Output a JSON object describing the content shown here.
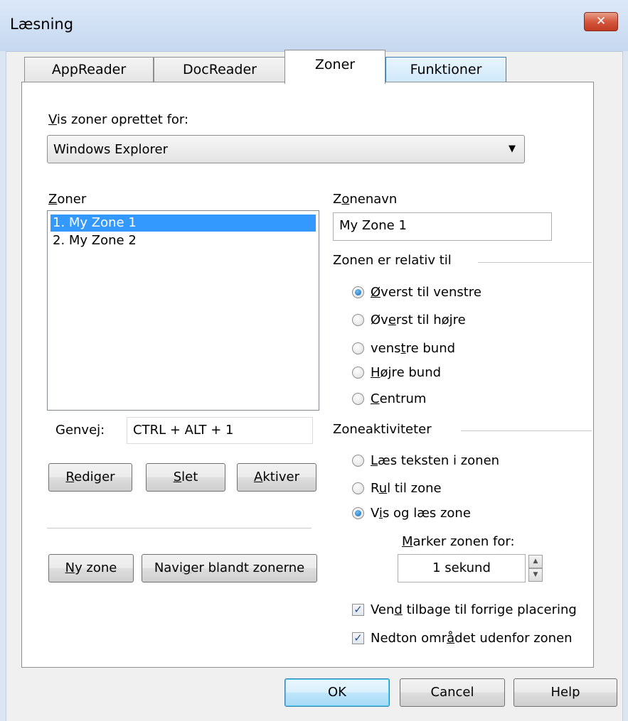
{
  "window": {
    "title": "Læsning",
    "close_label": "✕"
  },
  "tabs": [
    {
      "label": "AppReader"
    },
    {
      "label": "DocReader"
    },
    {
      "label": "Zoner"
    },
    {
      "label": "Funktioner"
    }
  ],
  "show_zones": {
    "label_accel": "V",
    "label_rest": "is zoner oprettet for:",
    "selected_value": "Windows Explorer"
  },
  "zones": {
    "label_accel": "Z",
    "label_rest": "oner",
    "items": [
      "1. My Zone 1",
      "2. My Zone 2"
    ],
    "selected_index": 0
  },
  "shortcut": {
    "label": "Genvej:",
    "value": "CTRL + ALT + 1"
  },
  "buttons": {
    "edit": {
      "accel": "R",
      "rest": "ediger"
    },
    "delete": {
      "accel": "S",
      "rest": "let"
    },
    "activate": {
      "accel": "A",
      "rest": "ktiver"
    },
    "new_zone": {
      "accel": "N",
      "rest": "y zone"
    },
    "navigate": {
      "pre": "Navi",
      "accel": "g",
      "rest": "er blandt zonerne"
    },
    "ok": "OK",
    "cancel": "Cancel",
    "help": "Help"
  },
  "zone_name": {
    "label_pre": "Z",
    "label_accel": "o",
    "label_rest": "nenavn",
    "value": "My Zone 1"
  },
  "relative": {
    "heading": "Zonen er relativ til",
    "options": [
      {
        "pre": "",
        "accel": "Ø",
        "rest": "verst til venstre",
        "checked": true
      },
      {
        "pre": "Øv",
        "accel": "e",
        "rest": "rst til højre",
        "checked": false
      },
      {
        "pre": "vens",
        "accel": "t",
        "rest": "re bund",
        "checked": false
      },
      {
        "pre": "",
        "accel": "H",
        "rest": "øjre bund",
        "checked": false
      },
      {
        "pre": "",
        "accel": "C",
        "rest": "entrum",
        "checked": false
      }
    ]
  },
  "activities": {
    "heading": "Zoneaktiviteter",
    "options": [
      {
        "pre": "",
        "accel": "L",
        "rest": "æs teksten i zonen",
        "checked": false
      },
      {
        "pre": "R",
        "accel": "u",
        "rest": "l til zone",
        "checked": false
      },
      {
        "pre": "V",
        "accel": "i",
        "rest": "s og læs zone",
        "checked": true
      }
    ]
  },
  "highlight": {
    "label_accel": "M",
    "label_rest": "arker zonen for:",
    "value": "1 sekund"
  },
  "checkboxes": [
    {
      "pre": "Ven",
      "accel": "d",
      "rest": " tilbage til forrige placering",
      "checked": true
    },
    {
      "pre": "Nedton omr",
      "accel": "å",
      "rest": "det udenfor zonen",
      "checked": true
    }
  ],
  "icons": {
    "dropdown": "chevron-down-icon",
    "spin_up": "spin-up-icon",
    "spin_down": "spin-down-icon",
    "close": "close-icon",
    "check": "checkmark-icon",
    "radio": "radio-dot-icon"
  },
  "colors": {
    "selection": "#3399ff",
    "close_button": "#c23a22",
    "titlebar": "#cfdff3",
    "radio_dot": "#1565b8"
  }
}
